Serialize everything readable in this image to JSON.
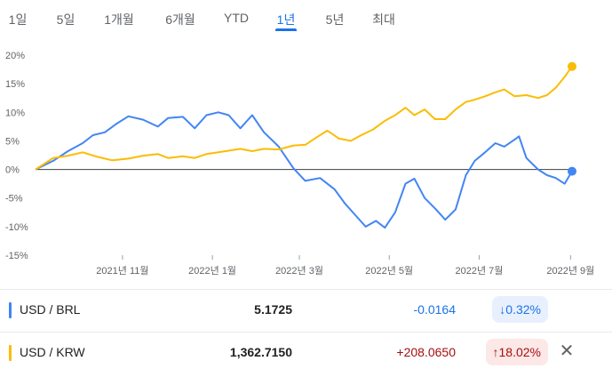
{
  "tabs": [
    {
      "label": "1일",
      "active": false
    },
    {
      "label": "5일",
      "active": false
    },
    {
      "label": "1개월",
      "active": false
    },
    {
      "label": "6개월",
      "active": false
    },
    {
      "label": "YTD",
      "active": false
    },
    {
      "label": "1년",
      "active": true
    },
    {
      "label": "5년",
      "active": false
    },
    {
      "label": "최대",
      "active": false
    }
  ],
  "chart_data": {
    "type": "line",
    "title": "",
    "xlabel": "",
    "ylabel": "",
    "ylim": [
      -15,
      20
    ],
    "yticks": [
      "20%",
      "15%",
      "10%",
      "5%",
      "0%",
      "-5%",
      "-10%",
      "-15%"
    ],
    "yticks_values": [
      20,
      15,
      10,
      5,
      0,
      -5,
      -10,
      -15
    ],
    "xticks": [
      "2021년 11월",
      "2022년 1월",
      "2022년 3월",
      "2022년 5월",
      "2022년 7월",
      "2022년 9월"
    ],
    "xticks_values": [
      "2021-11-01",
      "2022-01-01",
      "2022-03-01",
      "2022-05-01",
      "2022-07-01",
      "2022-09-01"
    ],
    "x_range": [
      "2021-09-03",
      "2022-09-02"
    ],
    "baseline": 0,
    "series": [
      {
        "name": "USD / BRL",
        "color": "#4285f4",
        "points": [
          [
            "2021-09-03",
            0
          ],
          [
            "2021-09-15",
            1.5
          ],
          [
            "2021-09-25",
            3.2
          ],
          [
            "2021-10-05",
            4.6
          ],
          [
            "2021-10-12",
            6.0
          ],
          [
            "2021-10-20",
            6.5
          ],
          [
            "2021-10-28",
            8.0
          ],
          [
            "2021-11-05",
            9.3
          ],
          [
            "2021-11-15",
            8.7
          ],
          [
            "2021-11-25",
            7.5
          ],
          [
            "2021-12-02",
            9.0
          ],
          [
            "2021-12-12",
            9.2
          ],
          [
            "2021-12-20",
            7.2
          ],
          [
            "2021-12-28",
            9.5
          ],
          [
            "2022-01-05",
            10.0
          ],
          [
            "2022-01-12",
            9.5
          ],
          [
            "2022-01-20",
            7.2
          ],
          [
            "2022-01-28",
            9.5
          ],
          [
            "2022-02-05",
            6.5
          ],
          [
            "2022-02-15",
            4.0
          ],
          [
            "2022-02-25",
            0.2
          ],
          [
            "2022-03-05",
            -2.0
          ],
          [
            "2022-03-15",
            -1.5
          ],
          [
            "2022-03-25",
            -3.5
          ],
          [
            "2022-04-01",
            -6.0
          ],
          [
            "2022-04-08",
            -8.0
          ],
          [
            "2022-04-15",
            -10.0
          ],
          [
            "2022-04-22",
            -9.0
          ],
          [
            "2022-04-28",
            -10.2
          ],
          [
            "2022-05-05",
            -7.5
          ],
          [
            "2022-05-12",
            -2.5
          ],
          [
            "2022-05-18",
            -1.6
          ],
          [
            "2022-05-25",
            -5.0
          ],
          [
            "2022-06-01",
            -6.8
          ],
          [
            "2022-06-08",
            -8.8
          ],
          [
            "2022-06-15",
            -7.0
          ],
          [
            "2022-06-22",
            -1.0
          ],
          [
            "2022-06-28",
            1.5
          ],
          [
            "2022-07-05",
            3.0
          ],
          [
            "2022-07-12",
            4.6
          ],
          [
            "2022-07-18",
            4.0
          ],
          [
            "2022-07-25",
            5.2
          ],
          [
            "2022-07-28",
            5.8
          ],
          [
            "2022-08-02",
            2.0
          ],
          [
            "2022-08-10",
            0
          ],
          [
            "2022-08-16",
            -1.0
          ],
          [
            "2022-08-22",
            -1.5
          ],
          [
            "2022-08-28",
            -2.5
          ],
          [
            "2022-09-02",
            -0.32
          ]
        ]
      },
      {
        "name": "USD / KRW",
        "color": "#fbbc04",
        "points": [
          [
            "2021-09-03",
            0
          ],
          [
            "2021-09-15",
            2.0
          ],
          [
            "2021-09-25",
            2.4
          ],
          [
            "2021-10-05",
            3.0
          ],
          [
            "2021-10-15",
            2.2
          ],
          [
            "2021-10-25",
            1.6
          ],
          [
            "2021-11-05",
            1.9
          ],
          [
            "2021-11-15",
            2.4
          ],
          [
            "2021-11-25",
            2.7
          ],
          [
            "2021-12-02",
            2.0
          ],
          [
            "2021-12-12",
            2.3
          ],
          [
            "2021-12-20",
            2.0
          ],
          [
            "2021-12-28",
            2.7
          ],
          [
            "2022-01-10",
            3.2
          ],
          [
            "2022-01-20",
            3.6
          ],
          [
            "2022-01-28",
            3.2
          ],
          [
            "2022-02-05",
            3.6
          ],
          [
            "2022-02-15",
            3.5
          ],
          [
            "2022-02-25",
            4.2
          ],
          [
            "2022-03-05",
            4.3
          ],
          [
            "2022-03-12",
            5.5
          ],
          [
            "2022-03-20",
            6.8
          ],
          [
            "2022-03-28",
            5.4
          ],
          [
            "2022-04-05",
            5.0
          ],
          [
            "2022-04-12",
            6.0
          ],
          [
            "2022-04-20",
            7.0
          ],
          [
            "2022-04-28",
            8.5
          ],
          [
            "2022-05-05",
            9.5
          ],
          [
            "2022-05-12",
            10.8
          ],
          [
            "2022-05-18",
            9.5
          ],
          [
            "2022-05-25",
            10.5
          ],
          [
            "2022-06-01",
            8.8
          ],
          [
            "2022-06-08",
            8.8
          ],
          [
            "2022-06-15",
            10.5
          ],
          [
            "2022-06-22",
            11.8
          ],
          [
            "2022-06-28",
            12.2
          ],
          [
            "2022-07-05",
            12.8
          ],
          [
            "2022-07-12",
            13.5
          ],
          [
            "2022-07-18",
            14.0
          ],
          [
            "2022-07-25",
            12.8
          ],
          [
            "2022-08-02",
            13.0
          ],
          [
            "2022-08-10",
            12.5
          ],
          [
            "2022-08-16",
            13.0
          ],
          [
            "2022-08-22",
            14.3
          ],
          [
            "2022-08-28",
            16.2
          ],
          [
            "2022-09-02",
            18.02
          ]
        ]
      }
    ]
  },
  "rows": [
    {
      "pair": "USD / BRL",
      "price": "5.1725",
      "change": "-0.0164",
      "percent": "↓0.32%",
      "color": "#4285f4",
      "change_color": "#1a73e8",
      "badge_bg": "#e8f0fe",
      "badge_color": "#1a73e8",
      "closable": false
    },
    {
      "pair": "USD / KRW",
      "price": "1,362.7150",
      "change": "+208.0650",
      "percent": "↑18.02%",
      "color": "#fbbc04",
      "change_color": "#a50e0e",
      "badge_bg": "#fce8e6",
      "badge_color": "#a50e0e",
      "closable": true
    }
  ],
  "icons": {
    "close": "close-icon"
  }
}
